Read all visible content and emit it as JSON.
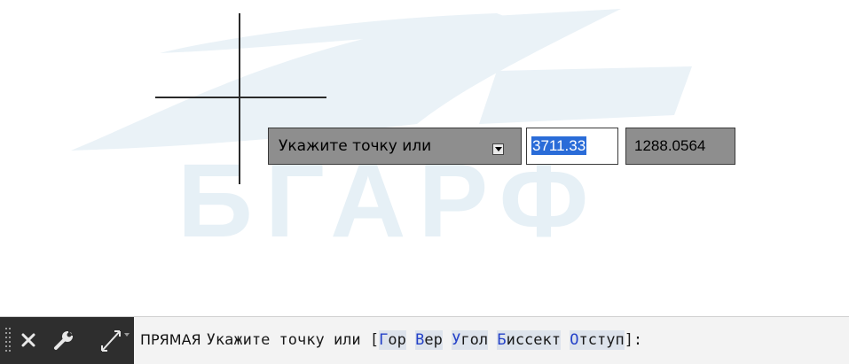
{
  "watermark": {
    "text": "БГАРФ"
  },
  "dynamic_input": {
    "prompt": "Укажите точку или",
    "x_value": "3711.33",
    "y_value": "1288.0564",
    "dropdown_icon": "dropdown-arrow-icon"
  },
  "command_line": {
    "close_icon": "close-icon",
    "customize_icon": "wrench-icon",
    "recent_icon": "xline-command-icon",
    "command_name": "ПРЯМАЯ",
    "prompt": "Укажите точку или [",
    "options": [
      {
        "key": "Г",
        "rest": "ор"
      },
      {
        "key": "В",
        "rest": "ер"
      },
      {
        "key": "У",
        "rest": "гол"
      },
      {
        "key": "Б",
        "rest": "иссект"
      },
      {
        "key": "О",
        "rest": "тступ"
      }
    ],
    "suffix": "]:"
  },
  "colors": {
    "tooltip_bg": "#8e8e8e",
    "selection": "#2a6cd8",
    "command_bar_dark": "#2e2e2e",
    "option_key": "#2441c8",
    "option_bg": "#dde3ec"
  }
}
